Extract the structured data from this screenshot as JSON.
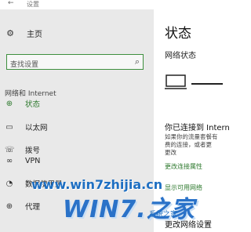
{
  "window": {
    "title": "设置",
    "back_glyph": "←"
  },
  "sidebar": {
    "home_label": "主页",
    "search_placeholder": "查找设置",
    "section_title": "网络和 Internet",
    "items": [
      {
        "label": "状态",
        "icon": "globe-icon",
        "active": true
      },
      {
        "label": "以太网",
        "icon": "ethernet-icon",
        "active": false
      },
      {
        "label": "拨号",
        "icon": "dialup-icon",
        "active": false
      },
      {
        "label": "VPN",
        "icon": "vpn-icon",
        "active": false
      },
      {
        "label": "数据使用量",
        "icon": "data-usage-icon",
        "active": false
      },
      {
        "label": "代理",
        "icon": "globe-proxy-icon",
        "active": false
      }
    ]
  },
  "main": {
    "title": "状态",
    "subtitle": "网络状态",
    "connected_text": "你已连接到 Intern",
    "description_lines": [
      "如果你的流量套餐有",
      "费的连接，或者更",
      "更改"
    ],
    "link_props": "更改连接属性",
    "link_available": "显示可用网络",
    "change_settings": "更改网络设置"
  },
  "watermark": {
    "url": "www.win7zhijia.cn",
    "logo": "WIN7.之家",
    "cn_text": "系统之家"
  },
  "colors": {
    "accent": "#2f7a2f",
    "sidebar_bg": "#e9e9e9",
    "search_border": "#3e8f3e",
    "watermark": "#1e6fc2"
  }
}
